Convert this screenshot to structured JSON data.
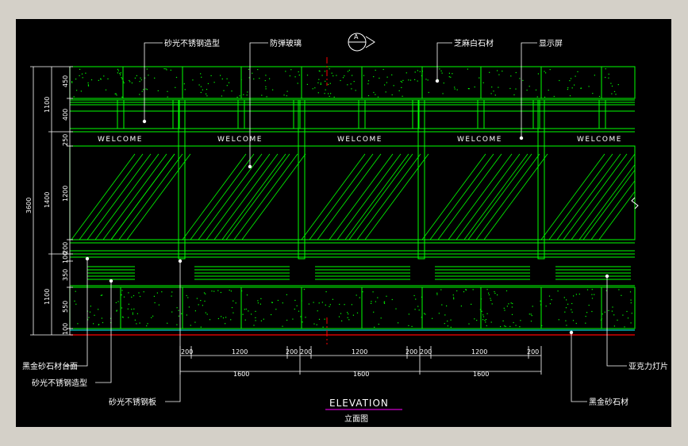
{
  "drawing": {
    "title": "ELEVATION",
    "subtitle": "立面图",
    "section_marker": "A",
    "welcome_text": "WELCOME"
  },
  "callouts_top": [
    "砂光不锈钢造型",
    "防弹玻璃",
    "芝麻白石材",
    "显示屏"
  ],
  "callouts_left": [
    "黑金砂石材台面",
    "砂光不锈钢造型",
    "砂光不锈钢板"
  ],
  "callouts_right": [
    "亚克力灯片",
    "黑金砂石材"
  ],
  "dims_left_outer": [
    "3600"
  ],
  "dims_left_middle": [
    "1100",
    "1400",
    "1100"
  ],
  "dims_left_inner": [
    "450",
    "400",
    "250",
    "1200",
    "200",
    "100",
    "350",
    "550",
    "100"
  ],
  "dims_bottom_row1": [
    "200",
    "1200",
    "200",
    "200",
    "1200",
    "200",
    "200",
    "1200",
    "200"
  ],
  "dims_bottom_row2": [
    "1600",
    "1600",
    "1600"
  ],
  "colors": {
    "background": "#000000",
    "frame": "#d4d0c8",
    "stone": "#00ff00",
    "stainless": "#00ff00",
    "glass": "#00ff00",
    "annotation": "#ffffff",
    "centerline": "#ff0000",
    "title_underline": "#ff00ff"
  }
}
